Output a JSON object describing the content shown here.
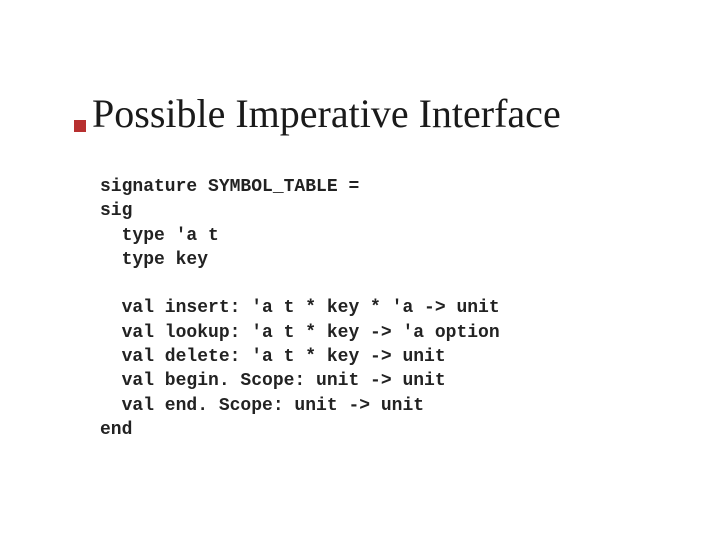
{
  "title": "Possible Imperative Interface",
  "code": {
    "l1": "signature SYMBOL_TABLE =",
    "l2": "sig",
    "l3": "  type 'a t",
    "l4": "  type key",
    "l5": "",
    "l6": "  val insert: 'a t * key * 'a -> unit",
    "l7": "  val lookup: 'a t * key -> 'a option",
    "l8": "  val delete: 'a t * key -> unit",
    "l9": "  val begin. Scope: unit -> unit",
    "l10": "  val end. Scope: unit -> unit",
    "l11": "end"
  }
}
